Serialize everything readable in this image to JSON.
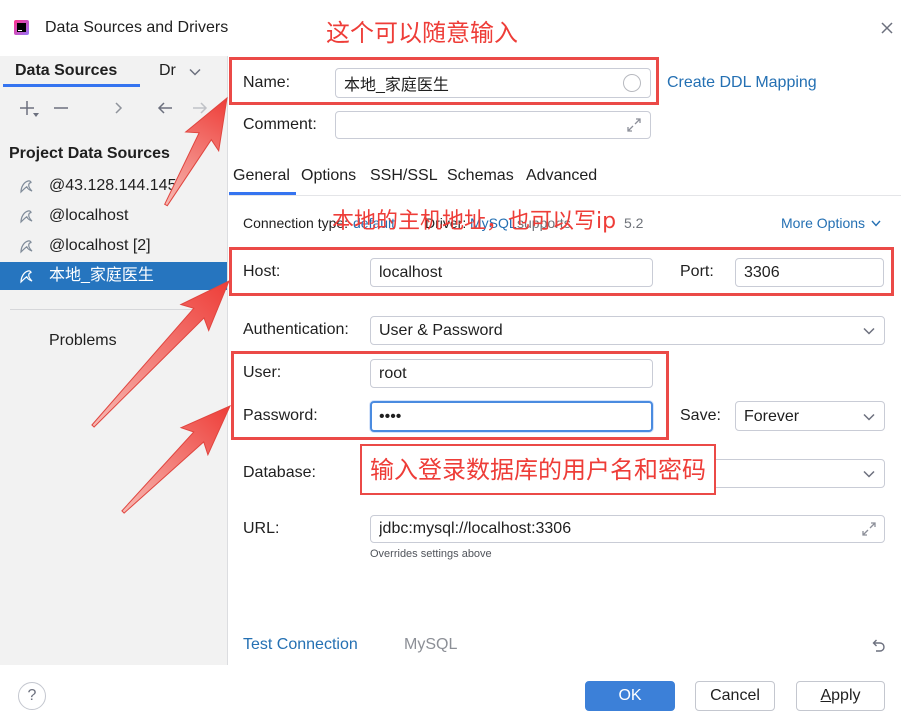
{
  "window": {
    "title": "Data Sources and Drivers",
    "app_icon": "datagrip-icon",
    "close_icon": "close-icon"
  },
  "sidebar": {
    "tabs": [
      {
        "label": "Data Sources",
        "active": true
      },
      {
        "label": "Dr",
        "active": false
      }
    ],
    "toolbar_icons": [
      "add-icon",
      "remove-icon",
      "expand-icon",
      "back-arrow-icon",
      "forward-arrow-icon"
    ],
    "section_title": "Project Data Sources",
    "items": [
      {
        "label": "@43.128.144.145",
        "icon": "mysql-icon",
        "selected": false
      },
      {
        "label": "@localhost",
        "icon": "mysql-icon",
        "selected": false
      },
      {
        "label": "@localhost [2]",
        "icon": "mysql-icon",
        "selected": false
      },
      {
        "label": "本地_家庭医生",
        "icon": "mysql-icon",
        "selected": true
      }
    ],
    "problems_label": "Problems"
  },
  "header": {
    "name_label": "Name:",
    "name_value": "本地_家庭医生",
    "create_ddl_link": "Create DDL Mapping",
    "comment_label": "Comment:",
    "comment_value": ""
  },
  "tabs": [
    {
      "label": "General",
      "active": true
    },
    {
      "label": "Options",
      "active": false
    },
    {
      "label": "SSH/SSL",
      "active": false
    },
    {
      "label": "Schemas",
      "active": false
    },
    {
      "label": "Advanced",
      "active": false
    }
  ],
  "general": {
    "connection_type_label": "Connection type:",
    "connection_type_value": "default",
    "driver_label": "Driver:",
    "driver_value": "MySQL",
    "driver_note": "supports",
    "driver_version": "5.2",
    "more_options": "More Options",
    "host_label": "Host:",
    "host_value": "localhost",
    "port_label": "Port:",
    "port_value": "3306",
    "auth_label": "Authentication:",
    "auth_value": "User & Password",
    "user_label": "User:",
    "user_value": "root",
    "password_label": "Password:",
    "password_value": "••••",
    "save_label": "Save:",
    "save_value": "Forever",
    "database_label": "Database:",
    "database_value": "",
    "url_label": "URL:",
    "url_value": "jdbc:mysql://localhost:3306",
    "url_hint": "Overrides settings above"
  },
  "footer": {
    "test_connection": "Test Connection",
    "driver_name": "MySQL",
    "revert_icon": "revert-icon",
    "help_label": "?",
    "ok_label": "OK",
    "cancel_label": "Cancel",
    "apply_label": "Apply"
  },
  "annotations": {
    "name_note": "这个可以随意输入",
    "host_note": "本地的主机地址，也可以写ip",
    "credentials_note": "输入登录数据库的用户名和密码"
  },
  "colors": {
    "accent": "#3574f0",
    "link": "#2470b3",
    "selection": "#2675bf",
    "ok_button": "#3c80d8",
    "annotation_red": "#ee3d38",
    "sidebar_bg": "#f2f2f2"
  }
}
